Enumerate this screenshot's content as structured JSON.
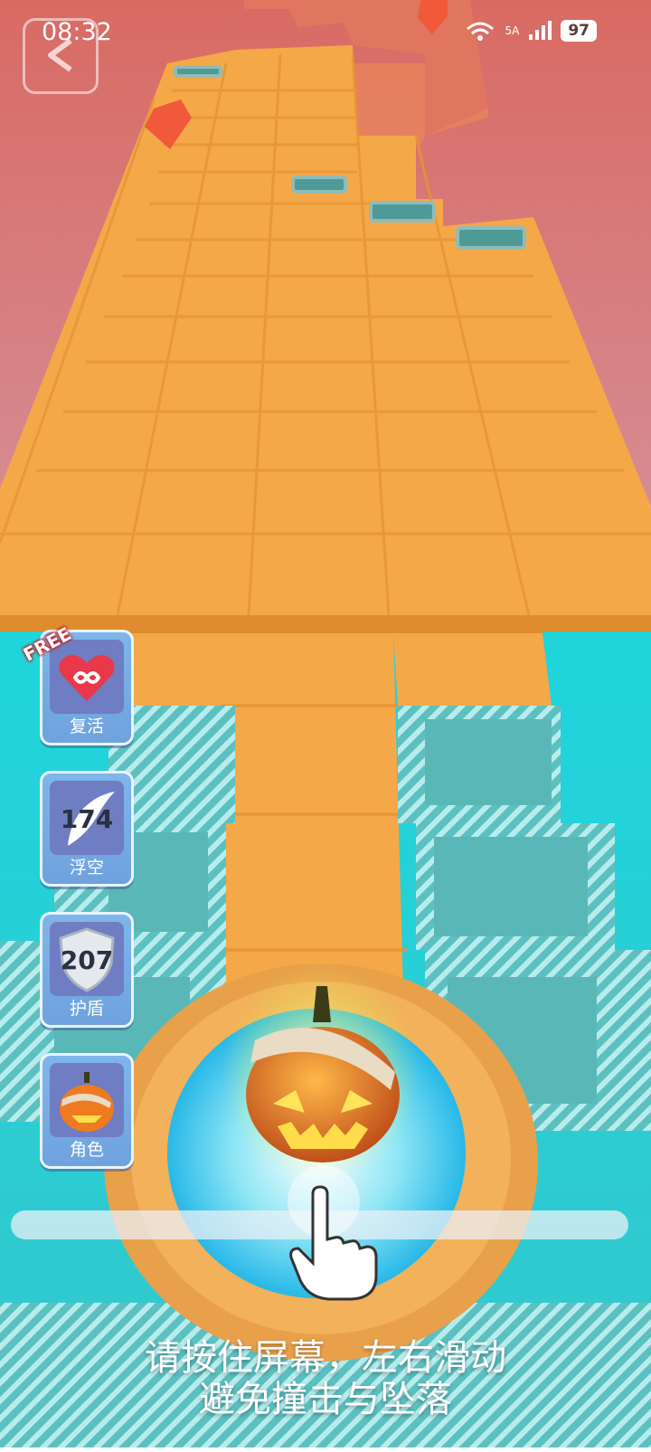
{
  "status_bar": {
    "time": "08:32",
    "network": "5A",
    "battery": "97"
  },
  "powerups": [
    {
      "label": "复活",
      "badge": "FREE",
      "icon": "heart-infinity-icon"
    },
    {
      "label": "浮空",
      "count": "174",
      "icon": "feather-icon"
    },
    {
      "label": "护盾",
      "count": "207",
      "icon": "shield-icon"
    },
    {
      "label": "角色",
      "icon": "pumpkin-icon"
    }
  ],
  "hint": {
    "line1": "请按住屏幕，左右滑动",
    "line2": "避免撞击与坠落"
  },
  "colors": {
    "track": "#f5a848",
    "water": "#20d4dc",
    "sky_top": "#d96a63",
    "button": "#7aaee6"
  }
}
